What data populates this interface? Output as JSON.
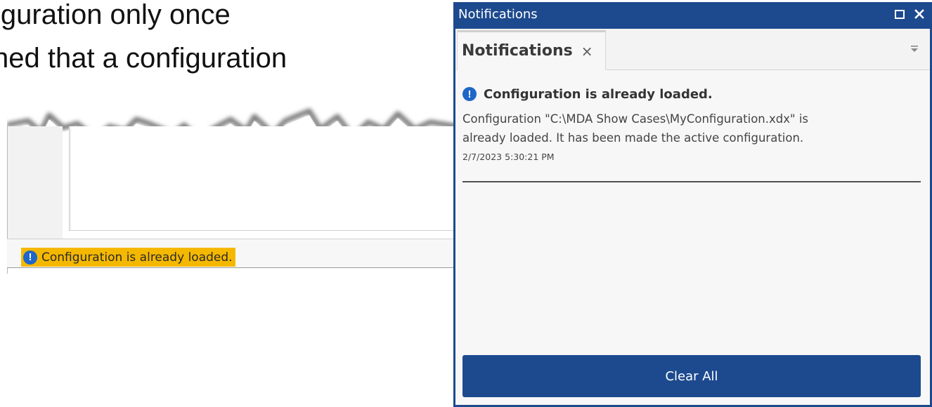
{
  "slide": {
    "line1": "iguration only once",
    "line2": "ned that a configuration"
  },
  "status_bar": {
    "message": "Configuration is already loaded.",
    "icon": "info-icon",
    "highlight_color": "#f5b800"
  },
  "notifications_window": {
    "title": "Notifications",
    "accent_color": "#1d4a8e",
    "tab": {
      "label": "Notifications",
      "close_glyph": "×"
    },
    "items": [
      {
        "icon": "info-icon",
        "heading": "Configuration is already loaded.",
        "message_line1": "Configuration \"C:\\MDA Show Cases\\MyConfiguration.xdx\" is",
        "message_line2": "already loaded. It has been made the active configuration.",
        "timestamp": "2/7/2023 5:30:21 PM"
      }
    ],
    "clear_all_label": "Clear All"
  }
}
